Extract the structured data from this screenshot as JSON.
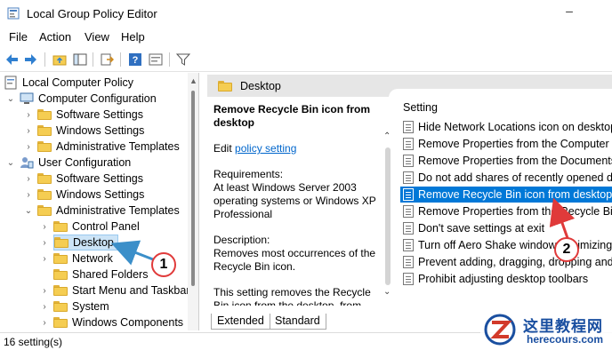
{
  "window": {
    "title": "Local Group Policy Editor",
    "minimize": "–",
    "close": "✕"
  },
  "menu": [
    "File",
    "Action",
    "View",
    "Help"
  ],
  "toolbar": {
    "icons": [
      "back-arrow-icon",
      "forward-arrow-icon",
      "folder-up-icon",
      "show-hide-tree-icon",
      "export-list-icon",
      "help-icon",
      "properties-icon",
      "filter-icon"
    ]
  },
  "tree": {
    "root": "Local Computer Policy",
    "computer_config": "Computer Configuration",
    "cc_software": "Software Settings",
    "cc_windows": "Windows Settings",
    "cc_admin": "Administrative Templates",
    "user_config": "User Configuration",
    "uc_software": "Software Settings",
    "uc_windows": "Windows Settings",
    "uc_admin": "Administrative Templates",
    "control_panel": "Control Panel",
    "desktop": "Desktop",
    "network": "Network",
    "shared_folders": "Shared Folders",
    "start_menu": "Start Menu and Taskbar",
    "system": "System",
    "windows_components": "Windows Components"
  },
  "right": {
    "header_title": "Desktop",
    "desc_title": "Remove Recycle Bin icon from desktop",
    "edit_prefix": "Edit",
    "edit_link": "policy setting",
    "requirements_label": "Requirements:",
    "requirements_text": "At least Windows Server 2003 operating systems or Windows XP Professional",
    "description_label": "Description:",
    "description_text": "Removes most occurrences of the Recycle Bin icon.",
    "description_more": "This setting removes the Recycle Bin icon from the desktop, from",
    "column_setting": "Setting",
    "settings": [
      "Hide Network Locations icon on desktop",
      "Remove Properties from the Computer icon",
      "Remove Properties from the Documents icon",
      "Do not add shares of recently opened documents",
      "Remove Recycle Bin icon from desktop",
      "Remove Properties from the Recycle Bin context menu",
      "Don't save settings at exit",
      "Turn off Aero Shake window minimizing",
      "Prevent adding, dragging, dropping and closing",
      "Prohibit adjusting desktop toolbars"
    ],
    "selected_index": 4,
    "tabs": [
      "Extended",
      "Standard"
    ]
  },
  "status": "16 setting(s)",
  "callouts": [
    "1",
    "2"
  ],
  "watermark": {
    "cn": "这里教程网",
    "en": "herecours.com"
  },
  "colors": {
    "selection": "#0078d7",
    "callout": "#e03a3a",
    "arrow": "#3b8fc9",
    "folder": "#f5cd52"
  }
}
